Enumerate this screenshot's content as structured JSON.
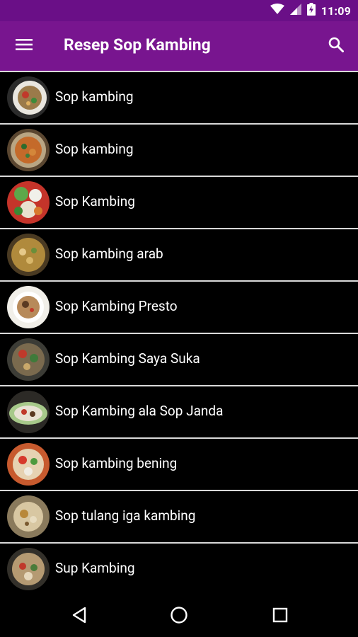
{
  "status_bar": {
    "time": "11:09"
  },
  "app_bar": {
    "title": "Resep Sop Kambing",
    "menu_icon": "hamburger-menu-icon",
    "search_icon": "search-icon"
  },
  "colors": {
    "status_bar": "#6a0f87",
    "app_bar": "#78158f",
    "list_background": "#000000",
    "divider": "#d9d9d9",
    "text": "#ffffff"
  },
  "recipes": [
    {
      "label": "Sop kambing"
    },
    {
      "label": "Sop kambing"
    },
    {
      "label": "Sop Kambing"
    },
    {
      "label": "Sop kambing arab"
    },
    {
      "label": "Sop Kambing Presto"
    },
    {
      "label": "Sop Kambing Saya Suka"
    },
    {
      "label": "Sop Kambing ala Sop Janda"
    },
    {
      "label": "Sop kambing bening"
    },
    {
      "label": "Sop tulang iga kambing"
    },
    {
      "label": "Sup Kambing"
    }
  ],
  "nav_bar": {
    "back_icon": "back-triangle-icon",
    "home_icon": "home-circle-icon",
    "recents_icon": "recents-square-icon"
  }
}
